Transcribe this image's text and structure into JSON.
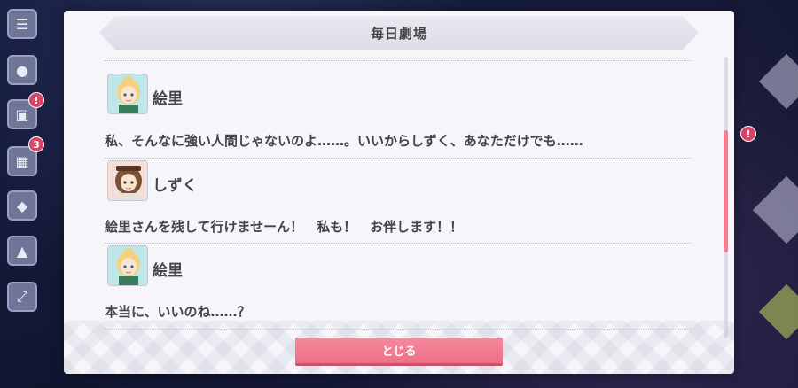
{
  "dialog": {
    "title": "毎日劇場",
    "close_label": "とじる"
  },
  "entries": [
    {
      "speaker": "絵里",
      "avatar": "eli-avatar",
      "text": "私、そんなに強い人間じゃないのよ……。いいからしずく、あなただけでも……"
    },
    {
      "speaker": "しずく",
      "avatar": "shizuku-avatar",
      "text": "絵里さんを残して行けませーん！　私も！　お伴します！！"
    },
    {
      "speaker": "絵里",
      "avatar": "eli-avatar",
      "text": "本当に、いいのね……？"
    }
  ],
  "background": {
    "badges": [
      "3"
    ],
    "colors": {
      "accent": "#ee6f86",
      "badge": "#d8446a",
      "panel": "#f5f5fa",
      "text": "#444444"
    }
  }
}
